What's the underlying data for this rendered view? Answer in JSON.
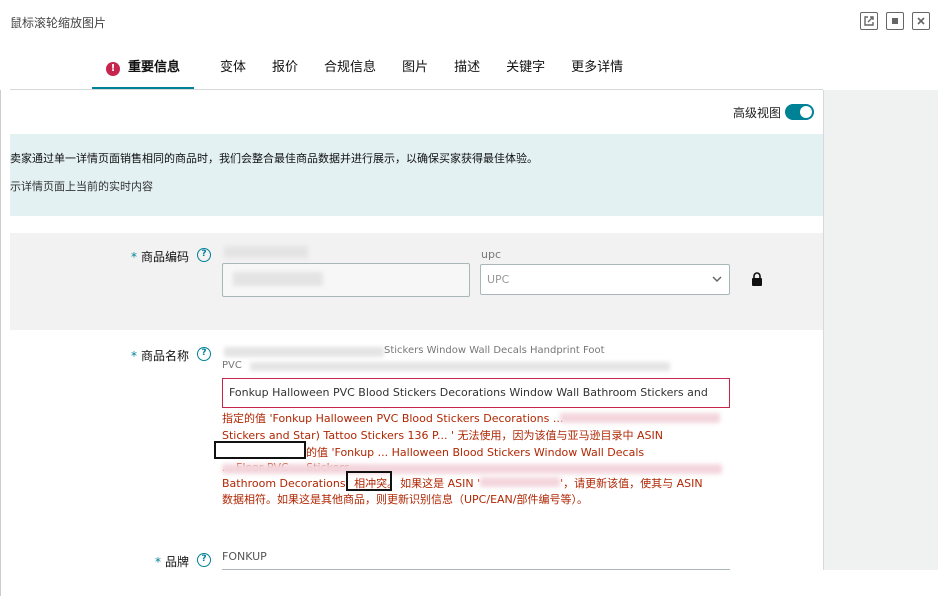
{
  "window": {
    "title": "鼠标滚轮缩放图片",
    "controls": [
      "open-external",
      "minimize",
      "close"
    ]
  },
  "tabs": [
    {
      "label": "重要信息",
      "active": true,
      "alert": "!"
    },
    {
      "label": "变体"
    },
    {
      "label": "报价"
    },
    {
      "label": "合规信息"
    },
    {
      "label": "图片"
    },
    {
      "label": "描述"
    },
    {
      "label": "关键字"
    },
    {
      "label": "更多详情"
    }
  ],
  "advanced_view": {
    "label": "高级视图",
    "enabled": true
  },
  "banner": {
    "line1": "卖家通过单一详情页面销售相同的商品时，我们会整合最佳商品数据并进行展示，以确保买家获得最佳体验。",
    "line2": "示详情页面上当前的实时内容"
  },
  "fields": {
    "product_id": {
      "label": "商品编码",
      "required": "*",
      "type_label": "upc",
      "type_value": "UPC"
    },
    "product_name": {
      "label": "商品名称",
      "required": "*",
      "current_line1": "Stickers Window Wall Decals Handprint Foot",
      "current_line2": "PVC",
      "input_value": "Fonkup Halloween PVC Blood Stickers Decorations Window Wall Bathroom Stickers and",
      "error_line1": "指定的值 'Fonkup Halloween PVC Blood Stickers Decorations ...",
      "error_line2": "Stickers and Star) Tattoo Stickers 136 P... ' 无法使用，因为该值与亚马逊目录中 ASIN",
      "error_line3": "的值 'Fonkup ... Halloween Blood Stickers Window Wall Decals",
      "error_line4": "... Floor PVC ... Stickers ...",
      "error_line5_a": "Bathroom Decorations' ",
      "error_line5_highlight": "相冲突。",
      "error_line5_b": "如果这是 ASIN '",
      "error_line5_c": "'，请更新该值，使其与 ASIN",
      "error_line6": "数据相符。如果这是其他商品，则更新识别信息（UPC/EAN/部件编号等）。"
    },
    "brand": {
      "label": "品牌",
      "required": "*",
      "value": "FONKUP"
    }
  },
  "colors": {
    "accent": "#008296",
    "error": "#b12704",
    "banner_bg": "#e3f1f3"
  }
}
